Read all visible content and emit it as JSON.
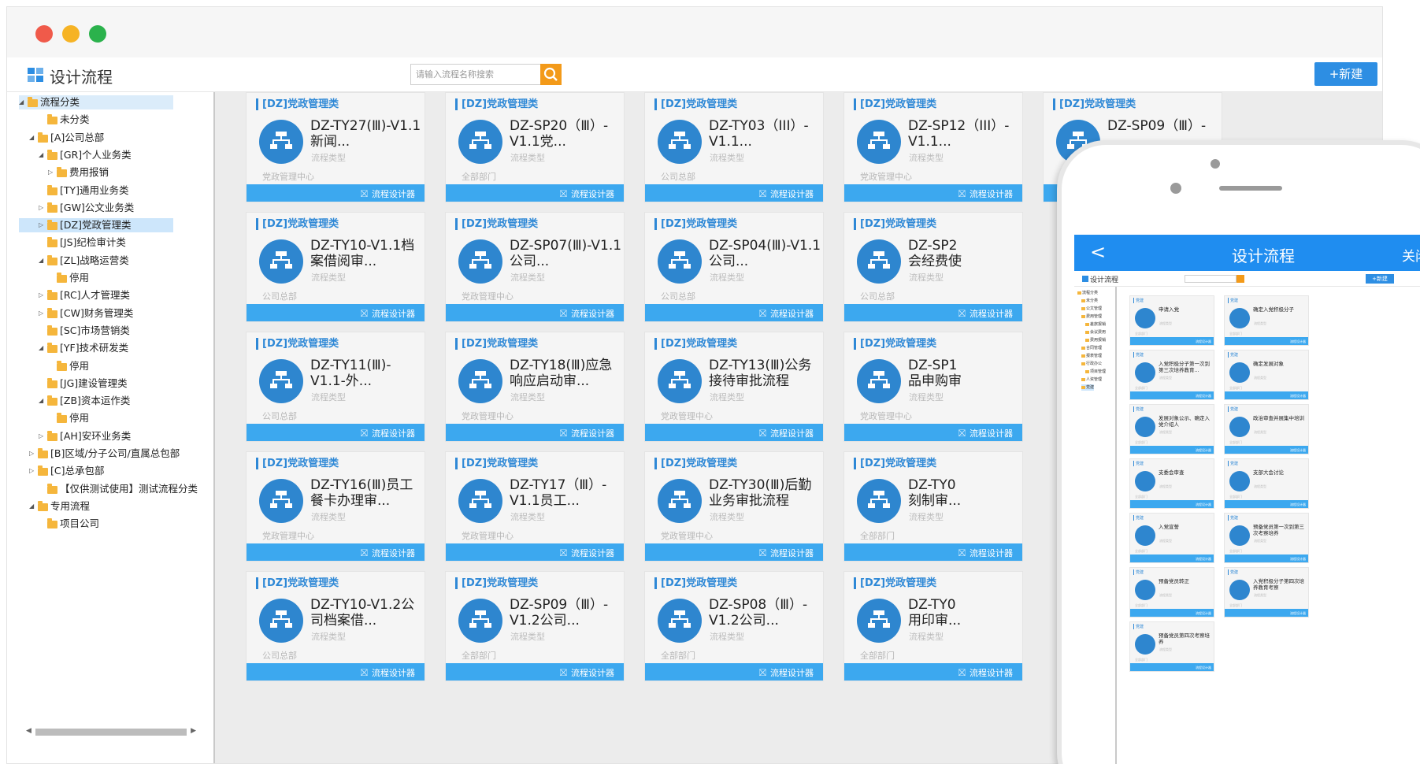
{
  "app": {
    "title": "设计流程",
    "search_placeholder": "请输入流程名称搜索",
    "new_button": "+新建"
  },
  "tree": [
    {
      "label": "流程分类",
      "toggle": "◢",
      "selected": false
    },
    {
      "label": "未分类",
      "toggle": "",
      "selected": false
    },
    {
      "label": "[A]公司总部",
      "toggle": "◢",
      "selected": false
    },
    {
      "label": "[GR]个人业务类",
      "toggle": "◢",
      "selected": false
    },
    {
      "label": "费用报销",
      "toggle": "▷",
      "selected": false
    },
    {
      "label": "[TY]通用业务类",
      "toggle": "",
      "selected": false
    },
    {
      "label": "[GW]公文业务类",
      "toggle": "▷",
      "selected": false
    },
    {
      "label": "[DZ]党政管理类",
      "toggle": "▷",
      "selected": true
    },
    {
      "label": "[JS]纪检审计类",
      "toggle": "",
      "selected": false
    },
    {
      "label": "[ZL]战略运营类",
      "toggle": "◢",
      "selected": false
    },
    {
      "label": "停用",
      "toggle": "",
      "selected": false
    },
    {
      "label": "[RC]人才管理类",
      "toggle": "▷",
      "selected": false
    },
    {
      "label": "[CW]财务管理类",
      "toggle": "▷",
      "selected": false
    },
    {
      "label": "[SC]市场营销类",
      "toggle": "",
      "selected": false
    },
    {
      "label": "[YF]技术研发类",
      "toggle": "◢",
      "selected": false
    },
    {
      "label": "停用",
      "toggle": "",
      "selected": false
    },
    {
      "label": "[JG]建设管理类",
      "toggle": "",
      "selected": false
    },
    {
      "label": "[ZB]资本运作类",
      "toggle": "◢",
      "selected": false
    },
    {
      "label": "停用",
      "toggle": "",
      "selected": false
    },
    {
      "label": "[AH]安环业务类",
      "toggle": "▷",
      "selected": false
    },
    {
      "label": "[B]区域/分子公司/直属总包部",
      "toggle": "▷",
      "selected": false
    },
    {
      "label": "[C]总承包部",
      "toggle": "▷",
      "selected": false
    },
    {
      "label": "【仅供测试使用】测试流程分类",
      "toggle": "",
      "selected": false
    },
    {
      "label": "专用流程",
      "toggle": "◢",
      "selected": false
    },
    {
      "label": "项目公司",
      "toggle": "",
      "selected": false
    }
  ],
  "card_common": {
    "category": "[DZ]党政管理类",
    "type_label": "流程类型",
    "designer_button": "流程设计器"
  },
  "cards": [
    {
      "name": "DZ-TY27(Ⅲ)-V1.1新闻...",
      "dept": "党政管理中心"
    },
    {
      "name": "DZ-SP20（Ⅲ）-V1.1党...",
      "dept": "全部部门"
    },
    {
      "name": "DZ-TY03（III）-V1.1...",
      "dept": "公司总部"
    },
    {
      "name": "DZ-SP12（III）-V1.1...",
      "dept": "党政管理中心"
    },
    {
      "name": "DZ-SP09（Ⅲ）-",
      "dept": ""
    },
    {
      "name": "DZ-TY10-V1.1档案借阅审...",
      "dept": "公司总部"
    },
    {
      "name": "DZ-SP07(Ⅲ)-V1.1公司...",
      "dept": "党政管理中心"
    },
    {
      "name": "DZ-SP04(Ⅲ)-V1.1公司...",
      "dept": "公司总部"
    },
    {
      "name": "DZ-SP2",
      "name2": "会经费使",
      "dept": "公司总部"
    },
    {
      "name": "DZ-TY11(Ⅲ)-V1.1-外...",
      "dept": "公司总部"
    },
    {
      "name": "DZ-TY18(Ⅲ)应急响应启动审...",
      "dept": "党政管理中心"
    },
    {
      "name": "DZ-TY13(Ⅲ)公务接待审批流程",
      "dept": "党政管理中心"
    },
    {
      "name": "DZ-SP1",
      "name2": "品申购审",
      "dept": "党政管理中心"
    },
    {
      "name": "DZ-TY16(Ⅲ)员工餐卡办理审...",
      "dept": "党政管理中心"
    },
    {
      "name": "DZ-TY17（Ⅲ）-V1.1员工...",
      "dept": "党政管理中心"
    },
    {
      "name": "DZ-TY30(Ⅲ)后勤业务审批流程",
      "dept": "党政管理中心"
    },
    {
      "name": "DZ-TY0",
      "name2": "刻制审...",
      "dept": "全部部门"
    },
    {
      "name": "DZ-TY10-V1.2公司档案借...",
      "dept": "公司总部"
    },
    {
      "name": "DZ-SP09（Ⅲ）-V1.2公司...",
      "dept": "全部部门"
    },
    {
      "name": "DZ-SP08（Ⅲ）-V1.2公司...",
      "dept": "全部部门"
    },
    {
      "name": "DZ-TY0",
      "name2": "用印审...",
      "dept": "全部部门"
    }
  ],
  "phone": {
    "nav_title": "设计流程",
    "back": "<",
    "close": "关闭",
    "mini_title": "设计流程",
    "mini_new": "+新建",
    "card_category": "党建",
    "card_type": "流程类型",
    "card_dept": "全部部门",
    "card_button": "流程设计器",
    "tree": [
      "流程分类",
      "未分类",
      "公文管理",
      "费用管理",
      "差旅报销",
      "会议费用",
      "费用报销",
      "合同管理",
      "报表管理",
      "行政办公",
      "项目管理",
      "人资管理",
      "党建"
    ],
    "cards": [
      "申请入党",
      "确定入党积极分子",
      "入党积极分子第一次到第三次培养教育...",
      "确定发展对象",
      "发展对象公示、确定入党介绍人",
      "政治审查并展集中培训",
      "支委会审查",
      "支部大会讨论",
      "入党宣誓",
      "预备党员第一次到第三次考察培养",
      "预备党员转正",
      "入党积极分子第四次培养教育考察",
      "预备党员第四次考察培养"
    ]
  },
  "colors": {
    "accent": "#2e88d6",
    "bar": "#3ca8ef",
    "search_button": "#f39a19",
    "nav": "#1f8df0"
  }
}
